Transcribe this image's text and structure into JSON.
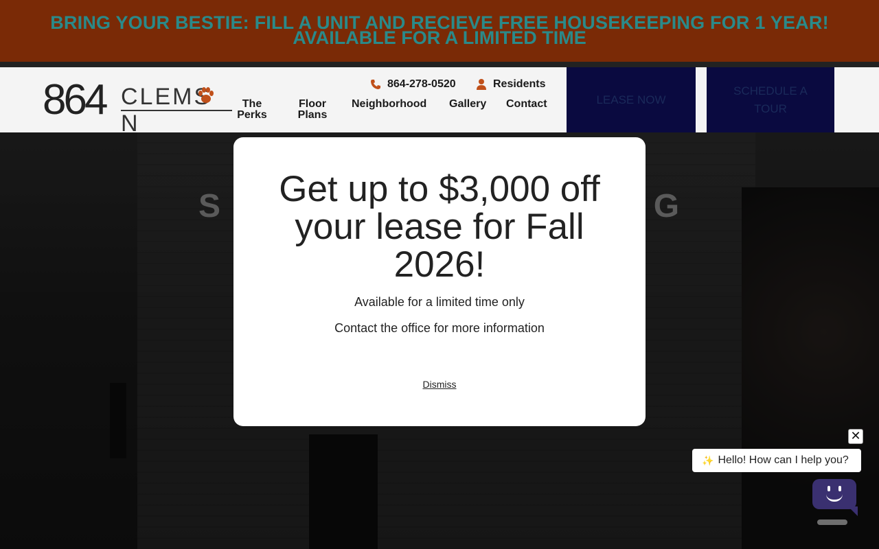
{
  "promo": {
    "line1": "BRING YOUR BESTIE: FILL A UNIT AND RECIEVE FREE HOUSEKEEPING FOR 1 YEAR!",
    "line2": "AVAILABLE FOR A LIMITED TIME"
  },
  "logo": {
    "digits": "864",
    "word": "CLEMS",
    "word_end": "N",
    "icon": "paw-print-icon"
  },
  "header": {
    "phone": "864-278-0520",
    "residents": "Residents",
    "nav": {
      "perks": "The Perks",
      "floor_plans": "Floor Plans",
      "neighborhood": "Neighborhood",
      "gallery": "Gallery",
      "contact": "Contact"
    },
    "lease_now": "LEASE NOW",
    "schedule_tour": "SCHEDULE A TOUR"
  },
  "hero": {
    "title": "S                                         G"
  },
  "modal": {
    "headline": "Get up to $3,000 off your lease for Fall 2026!",
    "line1": "Available for a limited time only",
    "line2": "Contact the office for more information",
    "dismiss": "Dismiss"
  },
  "chat": {
    "greeting": "Hello! How can I help you?",
    "close": "✕"
  },
  "colors": {
    "promo_bg": "#7a2a06",
    "button_bg": "#0a0a40",
    "accent_orange": "#c0501a"
  }
}
